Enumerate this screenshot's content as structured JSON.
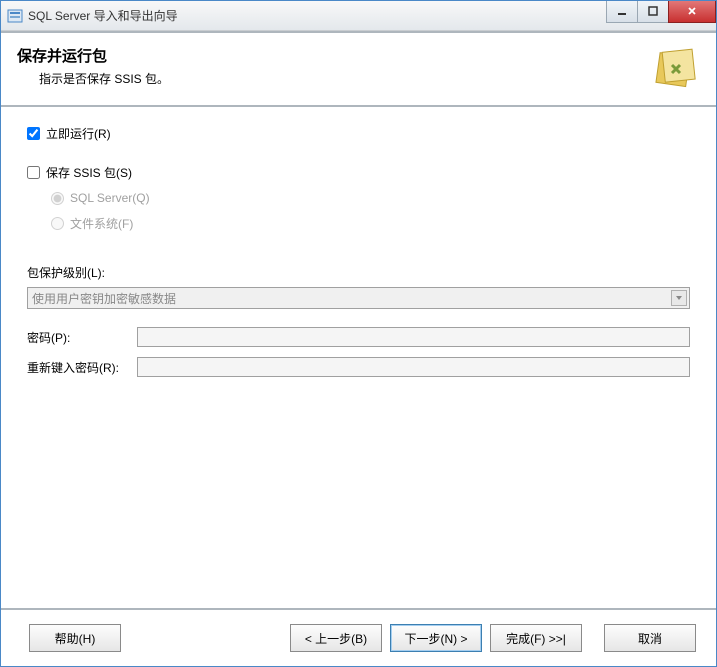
{
  "window": {
    "title": "SQL Server 导入和导出向导"
  },
  "header": {
    "title": "保存并运行包",
    "subtitle": "指示是否保存 SSIS 包。"
  },
  "options": {
    "run_now": {
      "label": "立即运行(R)",
      "checked": true
    },
    "save_ssis": {
      "label": "保存 SSIS 包(S)",
      "checked": false
    },
    "target_sqlserver": {
      "label": "SQL Server(Q)"
    },
    "target_filesystem": {
      "label": "文件系统(F)"
    }
  },
  "protection": {
    "label": "包保护级别(L):",
    "value": "使用用户密钥加密敏感数据"
  },
  "password": {
    "label": "密码(P):",
    "confirm_label": "重新键入密码(R):"
  },
  "footer": {
    "help": "帮助(H)",
    "back": "< 上一步(B)",
    "next": "下一步(N) >",
    "finish": "完成(F) >>|",
    "cancel": "取消"
  }
}
